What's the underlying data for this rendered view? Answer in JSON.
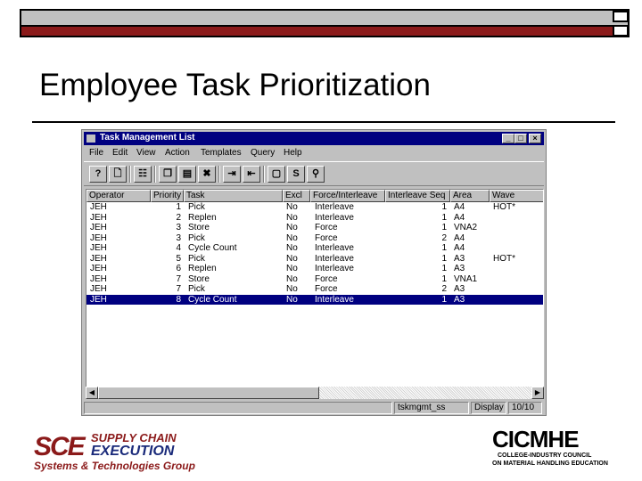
{
  "slide": {
    "title": "Employee Task Prioritization"
  },
  "window": {
    "title": "Task Management List",
    "menu": [
      "File",
      "Edit",
      "View",
      "Action",
      "Templates",
      "Query",
      "Help"
    ],
    "toolbar_icons": [
      "help-icon",
      "new-document-icon",
      "list-view-icon",
      "copy-icon",
      "paste-icon",
      "delete-icon",
      "import-icon",
      "export-icon",
      "preview-icon",
      "sort-icon",
      "search-icon"
    ],
    "columns": [
      "Operator",
      "Priority",
      "Task",
      "Excl",
      "Force/Interleave",
      "Interleave Seq",
      "Area",
      "Wave"
    ],
    "rows": [
      {
        "operator": "JEH",
        "priority": "1",
        "task": "Pick",
        "excl": "No",
        "force": "Interleave",
        "seq": "1",
        "area": "A4",
        "wave": "HOT*"
      },
      {
        "operator": "JEH",
        "priority": "2",
        "task": "Replen",
        "excl": "No",
        "force": "Interleave",
        "seq": "1",
        "area": "A4",
        "wave": ""
      },
      {
        "operator": "JEH",
        "priority": "3",
        "task": "Store",
        "excl": "No",
        "force": "Force",
        "seq": "1",
        "area": "VNA2",
        "wave": ""
      },
      {
        "operator": "JEH",
        "priority": "3",
        "task": "Pick",
        "excl": "No",
        "force": "Force",
        "seq": "2",
        "area": "A4",
        "wave": ""
      },
      {
        "operator": "JEH",
        "priority": "4",
        "task": "Cycle Count",
        "excl": "No",
        "force": "Interleave",
        "seq": "1",
        "area": "A4",
        "wave": ""
      },
      {
        "operator": "JEH",
        "priority": "5",
        "task": "Pick",
        "excl": "No",
        "force": "Interleave",
        "seq": "1",
        "area": "A3",
        "wave": "HOT*"
      },
      {
        "operator": "JEH",
        "priority": "6",
        "task": "Replen",
        "excl": "No",
        "force": "Interleave",
        "seq": "1",
        "area": "A3",
        "wave": ""
      },
      {
        "operator": "JEH",
        "priority": "7",
        "task": "Store",
        "excl": "No",
        "force": "Force",
        "seq": "1",
        "area": "VNA1",
        "wave": ""
      },
      {
        "operator": "JEH",
        "priority": "7",
        "task": "Pick",
        "excl": "No",
        "force": "Force",
        "seq": "2",
        "area": "A3",
        "wave": ""
      },
      {
        "operator": "JEH",
        "priority": "8",
        "task": "Cycle Count",
        "excl": "No",
        "force": "Interleave",
        "seq": "1",
        "area": "A3",
        "wave": ""
      }
    ],
    "selected_row": 9,
    "status": {
      "program": "tskmgmt_ss",
      "mode": "Display",
      "count": "10/10"
    }
  },
  "logos": {
    "sce": {
      "letters": "SCE",
      "line1": "SUPPLY CHAIN",
      "line2": "EXECUTION",
      "line3": "Systems & Technologies Group"
    },
    "cicmhe": {
      "name": "CICMHE",
      "line1": "COLLEGE-INDUSTRY COUNCIL",
      "line2": "ON MATERIAL HANDLING EDUCATION"
    }
  },
  "colors": {
    "accent_red": "#8b1a1a",
    "titlebar_blue": "#000080",
    "selection_blue": "#000080",
    "window_gray": "#c0c0c0"
  }
}
